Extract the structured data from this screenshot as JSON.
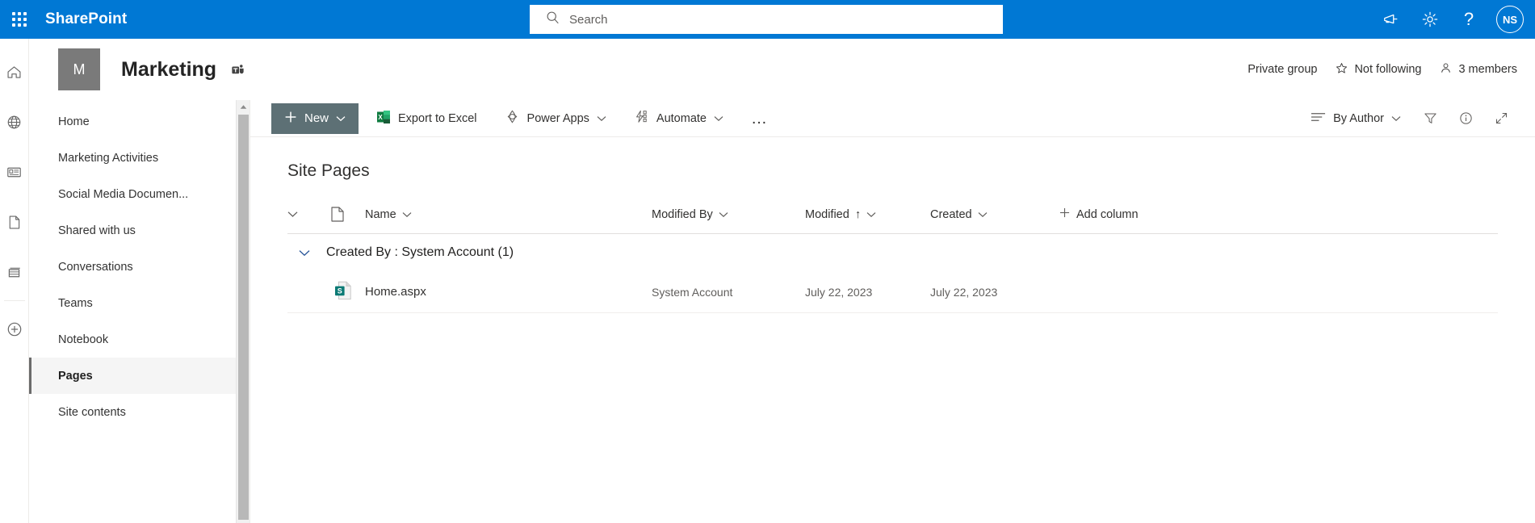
{
  "suite": {
    "waffle_name": "app-launcher",
    "brand": "SharePoint",
    "search": {
      "placeholder": "Search",
      "value": ""
    },
    "icons": [
      {
        "name": "megaphone-icon",
        "label": "Announcements"
      },
      {
        "name": "gear-icon",
        "label": "Settings"
      },
      {
        "name": "help-icon",
        "label": "?"
      }
    ],
    "avatar_initials": "NS",
    "accent_color": "#0078d4"
  },
  "app_rail": [
    {
      "name": "home-icon",
      "label": "Home"
    },
    {
      "name": "globe-icon",
      "label": "My sites"
    },
    {
      "name": "news-icon",
      "label": "News"
    },
    {
      "name": "page-icon",
      "label": "Pages"
    },
    {
      "name": "lists-icon",
      "label": "Lists"
    },
    {
      "name": "create-icon",
      "label": "Create"
    }
  ],
  "site_header": {
    "logo_letter": "M",
    "logo_color": "#7a7a7a",
    "title": "Marketing",
    "teams_icon": "teams-icon",
    "privacy": "Private group",
    "follow_label": "Not following",
    "members_label": "3 members"
  },
  "nav": {
    "items": [
      {
        "label": "Home",
        "selected": false
      },
      {
        "label": "Marketing Activities",
        "selected": false
      },
      {
        "label": "Social Media Documen...",
        "selected": false
      },
      {
        "label": "Shared with us",
        "selected": false
      },
      {
        "label": "Conversations",
        "selected": false
      },
      {
        "label": "Teams",
        "selected": false
      },
      {
        "label": "Notebook",
        "selected": false
      },
      {
        "label": "Pages",
        "selected": true
      },
      {
        "label": "Site contents",
        "selected": false
      }
    ]
  },
  "command_bar": {
    "new_label": "New",
    "export_label": "Export to Excel",
    "power_apps_label": "Power Apps",
    "automate_label": "Automate",
    "overflow_label": "…",
    "view_label": "By Author",
    "filter_icon": "filter-icon",
    "info_icon": "info-icon",
    "expand_icon": "expand-icon",
    "new_button_color": "#5d7075"
  },
  "list": {
    "title": "Site Pages",
    "columns": {
      "name": "Name",
      "modified_by": "Modified By",
      "modified": "Modified",
      "created": "Created",
      "add_column": "Add column"
    },
    "sort": {
      "column": "Modified",
      "direction": "↑"
    },
    "group": {
      "label": "Created By : System Account (1)",
      "expanded": true
    },
    "rows": [
      {
        "icon": "sharepoint-page-icon",
        "name": "Home.aspx",
        "modified_by": "System Account",
        "modified": "July 22, 2023",
        "created": "July 22, 2023"
      }
    ]
  }
}
